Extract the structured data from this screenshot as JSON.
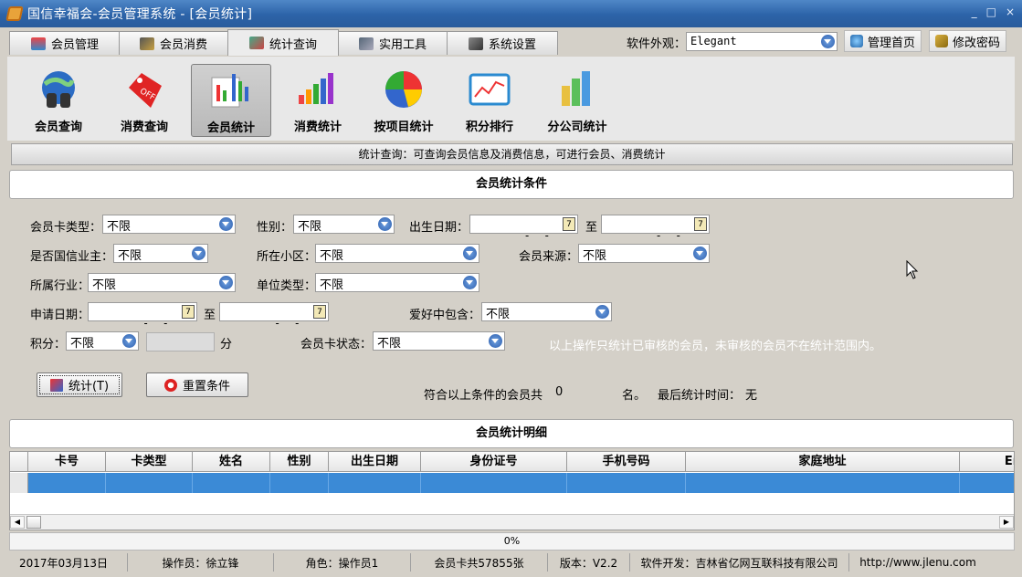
{
  "window": {
    "title": "国信幸福会-会员管理系统 - [会员统计]",
    "controls": [
      "_",
      "□",
      "×"
    ]
  },
  "tabs": [
    {
      "label": "会员管理",
      "icon": "members-icon",
      "active": false
    },
    {
      "label": "会员消费",
      "icon": "consume-icon",
      "active": false
    },
    {
      "label": "统计查询",
      "icon": "stats-icon",
      "active": true
    },
    {
      "label": "实用工具",
      "icon": "tools-icon",
      "active": false
    },
    {
      "label": "系统设置",
      "icon": "settings-icon",
      "active": false
    }
  ],
  "skin": {
    "label": "软件外观：",
    "value": "Elegant"
  },
  "top_links": {
    "home": "管理首页",
    "password": "修改密码"
  },
  "toolbar": [
    {
      "label": "会员查询",
      "icon": "globe-binoculars-icon"
    },
    {
      "label": "消费查询",
      "icon": "sale-tag-icon"
    },
    {
      "label": "会员统计",
      "icon": "report-chart-icon",
      "active": true
    },
    {
      "label": "消费统计",
      "icon": "bar-chart-icon"
    },
    {
      "label": "按项目统计",
      "icon": "pie-chart-icon"
    },
    {
      "label": "积分排行",
      "icon": "line-board-icon"
    },
    {
      "label": "分公司统计",
      "icon": "column-chart-icon"
    }
  ],
  "info_text": "统计查询：可查询会员信息及消费信息，可进行会员、消费统计",
  "criteria": {
    "title": "会员统计条件",
    "card_type_label": "会员卡类型：",
    "card_type": "不限",
    "gender_label": "性别：",
    "gender": "不限",
    "birth_label": "出生日期：",
    "birth_from": "  -  -",
    "to1": "至",
    "birth_to": "  -  -",
    "owner_label": "是否国信业主：",
    "owner": "不限",
    "area_label": "所在小区：",
    "area": "不限",
    "source_label": "会员来源：",
    "source": "不限",
    "industry_label": "所属行业：",
    "industry": "不限",
    "unit_label": "单位类型：",
    "unit": "不限",
    "apply_label": "申请日期：",
    "apply_from": "  -  -",
    "to2": "至",
    "apply_to": "  -  -",
    "hobby_label": "爱好中包含：",
    "hobby": "不限",
    "points_label": "积分：",
    "points": "不限",
    "points_unit": "分",
    "status_label": "会员卡状态：",
    "status": "不限",
    "note": "以上操作只统计已审核的会员，未审核的会员不在统计范围内。",
    "stat_button": "统计(T)",
    "reset_button": "重置条件",
    "result_prefix": "符合以上条件的会员共",
    "result_count": "0",
    "result_unit": "名。",
    "last_time_label": "最后统计时间：",
    "last_time": "无",
    "cal_glyph": "7"
  },
  "detail": {
    "title": "会员统计明细",
    "columns": [
      "卡号",
      "卡类型",
      "姓名",
      "性别",
      "出生日期",
      "身份证号",
      "手机号码",
      "家庭地址",
      "En"
    ]
  },
  "progress": "0%",
  "status": {
    "date": "2017年03月13日",
    "operator": "操作员：徐立锋",
    "role": "角色：操作员1",
    "cards": "会员卡共57855张",
    "version": "版本：V2.2",
    "developer": "软件开发：吉林省亿网互联科技有限公司",
    "url": "http://www.jlenu.com"
  },
  "colors": {
    "title_bar": "#2c63a8",
    "selected_row": "#3b8ad6",
    "accent_icon": "#2d5fae"
  }
}
